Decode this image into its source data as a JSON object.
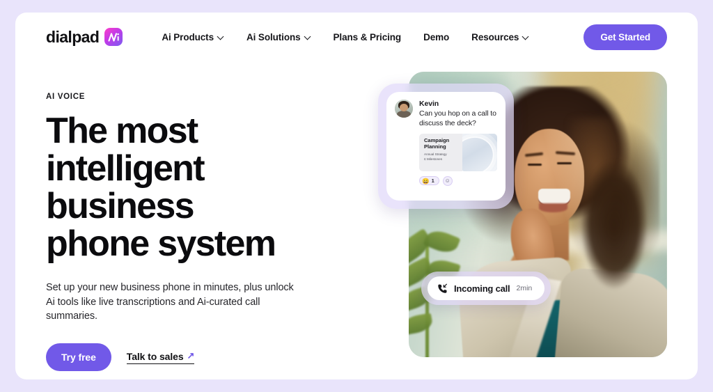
{
  "brand": {
    "word": "dialpad",
    "badge_icon": "dialpad-ai-logo-icon"
  },
  "nav": {
    "items": [
      {
        "label": "Ai Products",
        "has_caret": true
      },
      {
        "label": "Ai Solutions",
        "has_caret": true
      },
      {
        "label": "Plans & Pricing",
        "has_caret": false
      },
      {
        "label": "Demo",
        "has_caret": false
      },
      {
        "label": "Resources",
        "has_caret": true
      }
    ],
    "cta_label": "Get Started"
  },
  "hero": {
    "eyebrow": "AI VOICE",
    "headline": "The most intelligent business phone system",
    "subhead": "Set up your new business phone in minutes, plus unlock Ai tools like live transcriptions and Ai-curated call summaries.",
    "primary_cta": "Try free",
    "secondary_cta": "Talk to sales",
    "secondary_cta_arrow": "↗"
  },
  "chat_card": {
    "sender": "Kevin",
    "message": "Can you hop on a call to discuss the deck?",
    "attachment": {
      "title": "Campaign Planning",
      "line1": "Annual Strategy",
      "line2": "Ɛ Milestones"
    },
    "reaction": {
      "emoji": "😄",
      "count": "1",
      "add_label": "☺"
    }
  },
  "call_notification": {
    "label": "Incoming call",
    "duration": "2min",
    "icon": "incoming-call-icon"
  },
  "colors": {
    "accent_purple": "#7159e8",
    "page_background": "#e9e4fb",
    "card_background": "#ffffff",
    "text_primary": "#0b0b0e"
  }
}
